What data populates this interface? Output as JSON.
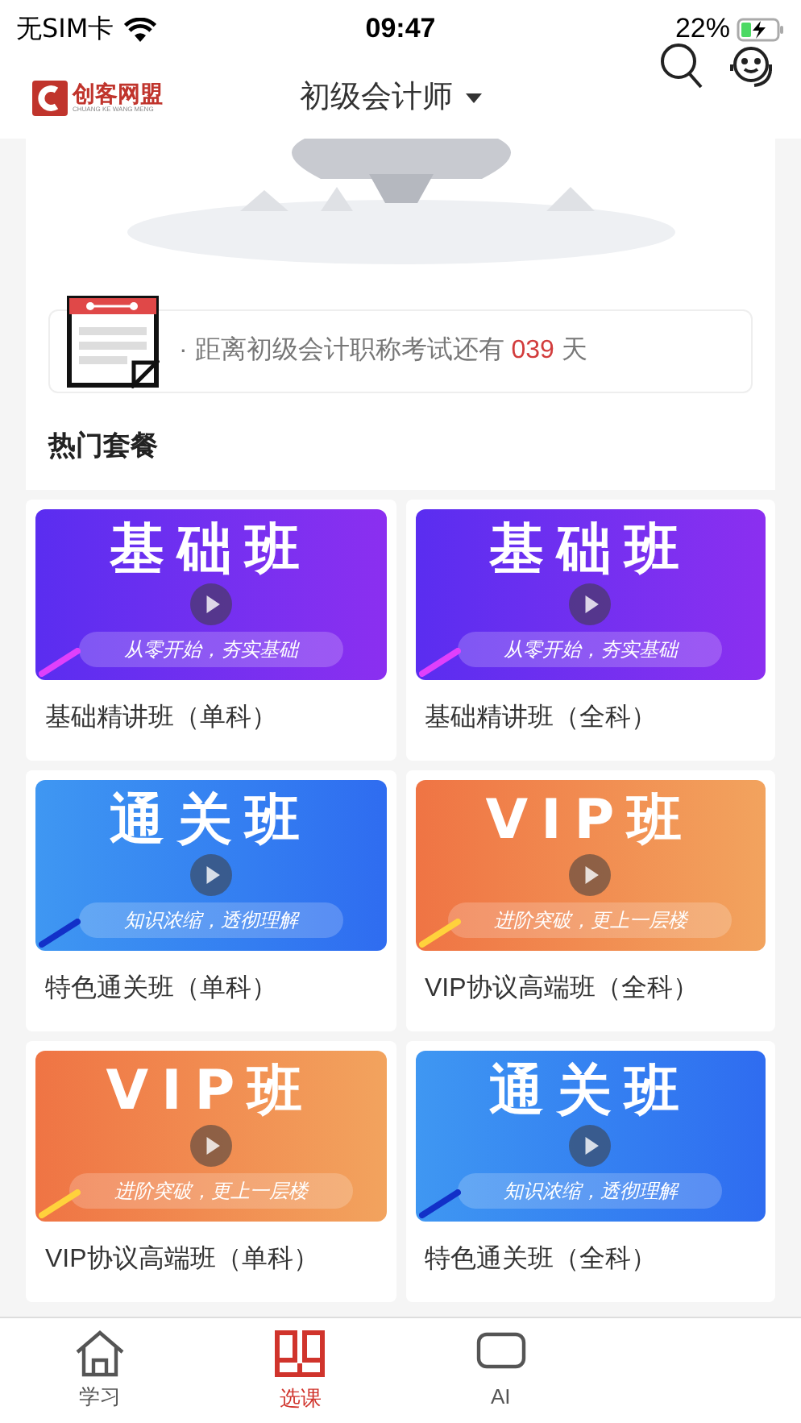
{
  "status_bar": {
    "carrier": "无SIM卡",
    "time": "09:47",
    "battery": "22%"
  },
  "header": {
    "logo_text": "创客网盟",
    "logo_subtext": "CHUANG KE WANG MENG",
    "title": "初级会计师"
  },
  "countdown": {
    "prefix": "· 距离初级会计职称考试还有",
    "days": "039",
    "suffix": "天"
  },
  "section_title": "热门套餐",
  "packages": [
    {
      "kind": "purple",
      "image_title": "基础班",
      "image_subtitle": "从零开始，夯实基础",
      "name": "基础精讲班（单科）"
    },
    {
      "kind": "purple",
      "image_title": "基础班",
      "image_subtitle": "从零开始，夯实基础",
      "name": "基础精讲班（全科）"
    },
    {
      "kind": "blue",
      "image_title": "通关班",
      "image_subtitle": "知识浓缩，透彻理解",
      "name": "特色通关班（单科）"
    },
    {
      "kind": "orange",
      "image_title": "VIP班",
      "image_subtitle": "进阶突破，更上一层楼",
      "name": "VIP协议高端班（全科）"
    },
    {
      "kind": "orange",
      "image_title": "VIP班",
      "image_subtitle": "进阶突破，更上一层楼",
      "name": "VIP协议高端班（单科）"
    },
    {
      "kind": "blue",
      "image_title": "通关班",
      "image_subtitle": "知识浓缩，透彻理解",
      "name": "特色通关班（全科）"
    }
  ],
  "tab_bar": [
    {
      "kind": "home",
      "label": "学习",
      "selected": false
    },
    {
      "kind": "book",
      "label": "选课",
      "selected": true
    },
    {
      "kind": "ai",
      "label": "AI",
      "selected": false
    }
  ]
}
